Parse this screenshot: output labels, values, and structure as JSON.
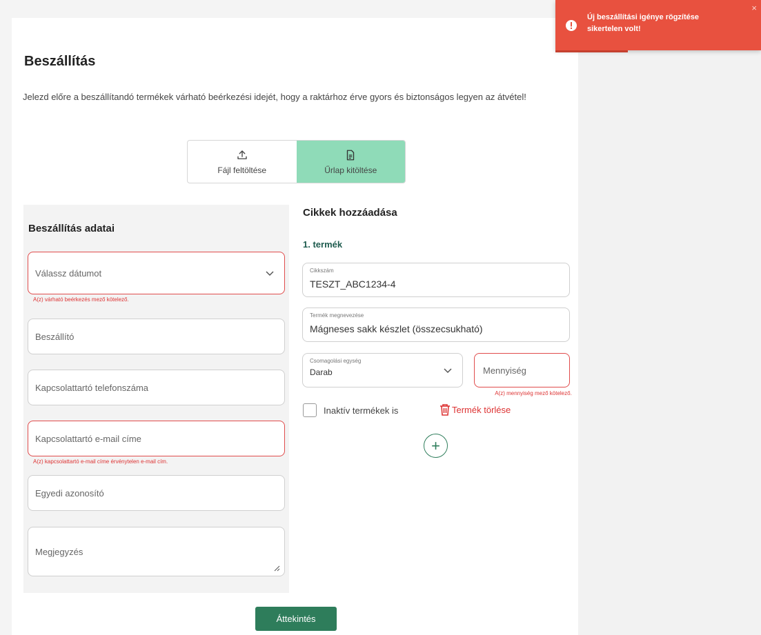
{
  "page": {
    "title": "Beszállítás",
    "intro": "Jelezd előre a beszállítandó termékek várható beérkezési idejét, hogy a raktárhoz érve gyors és biztonságos legyen az átvétel!"
  },
  "mode_toggle": {
    "file_upload": "Fájl feltöltése",
    "form_fill": "Űrlap kitöltése",
    "active": "form_fill"
  },
  "delivery": {
    "title": "Beszállítás adatai",
    "date_placeholder": "Válassz dátumot",
    "date_error": "A(z) várható beérkezés mező kötelező.",
    "supplier_placeholder": "Beszállító",
    "phone_placeholder": "Kapcsolattartó telefonszáma",
    "email_placeholder": "Kapcsolattartó e-mail címe",
    "email_error": "A(z) kapcsolattartó e-mail címe érvénytelen e-mail cím.",
    "custom_id_placeholder": "Egyedi azonosító",
    "note_placeholder": "Megjegyzés"
  },
  "items": {
    "title": "Cikkek hozzáadása",
    "product_heading": "1. termék",
    "sku_label": "Cikkszám",
    "sku_value": "TESZT_ABC1234-4",
    "name_label": "Termék megnevezése",
    "name_value": "Mágneses sakk készlet (összecsukható)",
    "unit_label": "Csomagolási egység",
    "unit_value": "Darab",
    "qty_placeholder": "Mennyiség",
    "qty_error": "A(z) mennyiség mező kötelező.",
    "inactive_label": "Inaktív termékek is",
    "delete_label": "Termék törlése",
    "add_symbol": "+"
  },
  "actions": {
    "review": "Áttekintés"
  },
  "toast": {
    "message": "Új beszállítási igénye rögzítése sikertelen volt!",
    "close": "×"
  },
  "colors": {
    "accent": "#2e7d5b",
    "toggle_active": "#8fdbb8",
    "error": "#e04b4b",
    "toast": "#e8513f"
  }
}
